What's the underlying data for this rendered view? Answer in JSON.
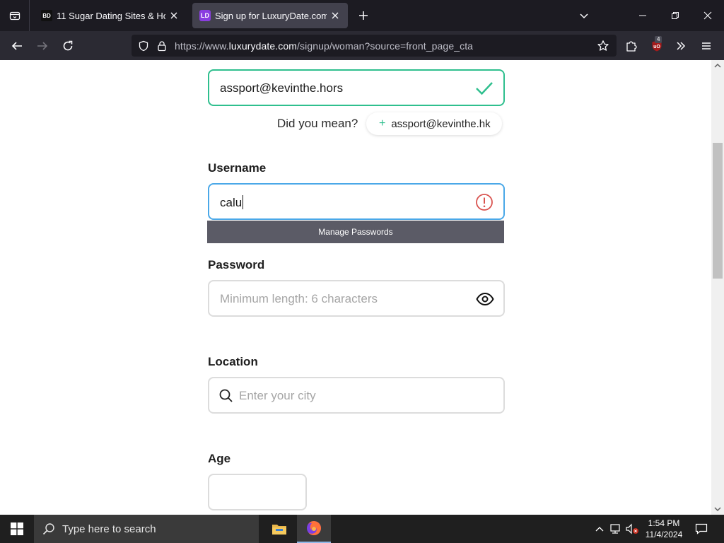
{
  "browser": {
    "tabs": [
      {
        "title": "11 Sugar Dating Sites & How to",
        "favicon_text": "BD",
        "active": false
      },
      {
        "title": "Sign up for LuxuryDate.com",
        "favicon_text": "LD",
        "active": true
      }
    ],
    "url": {
      "prefix": "https://www.",
      "host": "luxurydate.com",
      "path": "/signup/woman?source=front_page_cta"
    },
    "ublock_count": "4"
  },
  "form": {
    "email": {
      "value": "assport@kevinthe.hors",
      "status_icon": "check-icon",
      "status_color": "#2fbf8e"
    },
    "suggestion": {
      "prompt": "Did you mean?",
      "plus": "+",
      "value": "assport@kevinthe.hk"
    },
    "username": {
      "label": "Username",
      "value": "calu",
      "status_icon": "alert-circle-icon",
      "status_color": "#d9534f"
    },
    "manage_passwords": "Manage Passwords",
    "password": {
      "label": "Password",
      "placeholder": "Minimum length: 6 characters",
      "toggle_icon": "eye-icon"
    },
    "location": {
      "label": "Location",
      "placeholder": "Enter your city"
    },
    "age": {
      "label": "Age",
      "value": ""
    }
  },
  "taskbar": {
    "search_placeholder": "Type here to search",
    "time": "1:54 PM",
    "date": "11/4/2024"
  }
}
